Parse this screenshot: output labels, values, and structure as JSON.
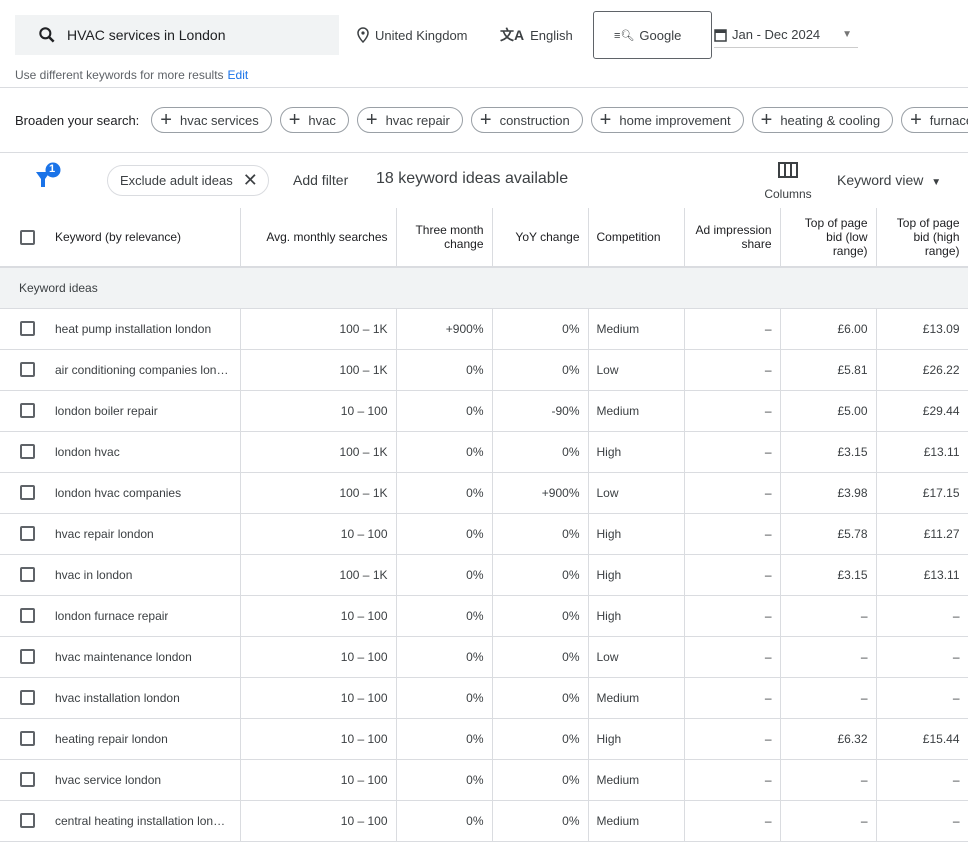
{
  "search": {
    "query": "HVAC services in London",
    "location": "United Kingdom",
    "language": "English",
    "network": "Google",
    "date_range": "Jan - Dec 2024",
    "hint": "Use different keywords for more results",
    "edit": "Edit"
  },
  "broaden": {
    "label": "Broaden your search:",
    "chips": [
      "hvac services",
      "hvac",
      "hvac repair",
      "construction",
      "home improvement",
      "heating & cooling",
      "furnace"
    ]
  },
  "filters": {
    "badge": "1",
    "exclude": "Exclude adult ideas",
    "add_filter": "Add filter",
    "count": "18 keyword ideas available",
    "columns": "Columns",
    "view": "Keyword view"
  },
  "table": {
    "headers": [
      "Keyword (by relevance)",
      "Avg. monthly searches",
      "Three month change",
      "YoY change",
      "Competition",
      "Ad impression share",
      "Top of page bid (low range)",
      "Top of page bid (high range)"
    ],
    "section": "Keyword ideas",
    "rows": [
      [
        "heat pump installation london",
        "100 – 1K",
        "+900%",
        "0%",
        "Medium",
        "–",
        "£6.00",
        "£13.09"
      ],
      [
        "air conditioning companies london",
        "100 – 1K",
        "0%",
        "0%",
        "Low",
        "–",
        "£5.81",
        "£26.22"
      ],
      [
        "london boiler repair",
        "10 – 100",
        "0%",
        "-90%",
        "Medium",
        "–",
        "£5.00",
        "£29.44"
      ],
      [
        "london hvac",
        "100 – 1K",
        "0%",
        "0%",
        "High",
        "–",
        "£3.15",
        "£13.11"
      ],
      [
        "london hvac companies",
        "100 – 1K",
        "0%",
        "+900%",
        "Low",
        "–",
        "£3.98",
        "£17.15"
      ],
      [
        "hvac repair london",
        "10 – 100",
        "0%",
        "0%",
        "High",
        "–",
        "£5.78",
        "£11.27"
      ],
      [
        "hvac in london",
        "100 – 1K",
        "0%",
        "0%",
        "High",
        "–",
        "£3.15",
        "£13.11"
      ],
      [
        "london furnace repair",
        "10 – 100",
        "0%",
        "0%",
        "High",
        "–",
        "–",
        "–"
      ],
      [
        "hvac maintenance london",
        "10 – 100",
        "0%",
        "0%",
        "Low",
        "–",
        "–",
        "–"
      ],
      [
        "hvac installation london",
        "10 – 100",
        "0%",
        "0%",
        "Medium",
        "–",
        "–",
        "–"
      ],
      [
        "heating repair london",
        "10 – 100",
        "0%",
        "0%",
        "High",
        "–",
        "£6.32",
        "£15.44"
      ],
      [
        "hvac service london",
        "10 – 100",
        "0%",
        "0%",
        "Medium",
        "–",
        "–",
        "–"
      ],
      [
        "central heating installation london",
        "10 – 100",
        "0%",
        "0%",
        "Medium",
        "–",
        "–",
        "–"
      ]
    ]
  },
  "colors": {
    "accent": "#1a73e8"
  }
}
